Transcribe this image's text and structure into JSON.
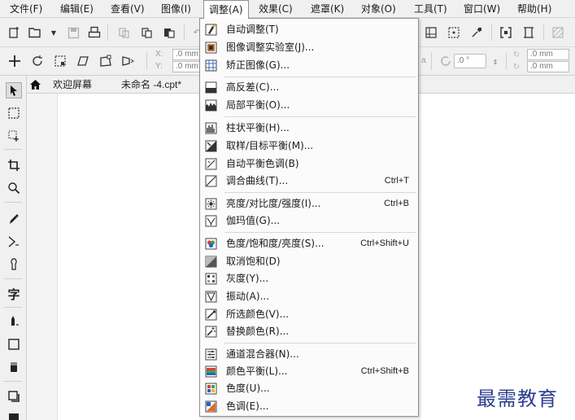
{
  "menubar": {
    "items": [
      {
        "label": "文件(F)"
      },
      {
        "label": "编辑(E)"
      },
      {
        "label": "查看(V)"
      },
      {
        "label": "图像(I)"
      },
      {
        "label": "调整(A)",
        "active": true
      },
      {
        "label": "效果(C)"
      },
      {
        "label": "遮罩(K)"
      },
      {
        "label": "对象(O)"
      },
      {
        "label": "工具(T)"
      },
      {
        "label": "窗口(W)"
      },
      {
        "label": "帮助(H)"
      }
    ]
  },
  "toolbar2": {
    "x_label": "X:",
    "y_label": "Y:",
    "x_value": ".0 mm",
    "y_value": ".0 mm",
    "rotation_value": ".0 °",
    "w_value": ".0 mm",
    "h_value": ".0 mm"
  },
  "doc_tabs": {
    "welcome": "欢迎屏幕",
    "document": "未命名 -4.cpt*"
  },
  "toolbox": {
    "text_tool_glyph": "字"
  },
  "adjust_menu": {
    "items": [
      {
        "label": "自动调整(T)",
        "shortcut": ""
      },
      {
        "label": "图像调整实验室(J)...",
        "shortcut": ""
      },
      {
        "label": "矫正图像(G)...",
        "shortcut": ""
      },
      {
        "label": "高反差(C)...",
        "shortcut": ""
      },
      {
        "label": "局部平衡(O)...",
        "shortcut": ""
      },
      {
        "label": "柱状平衡(H)...",
        "shortcut": ""
      },
      {
        "label": "取样/目标平衡(M)...",
        "shortcut": ""
      },
      {
        "label": "自动平衡色调(B)",
        "shortcut": ""
      },
      {
        "label": "调合曲线(T)...",
        "shortcut": "Ctrl+T"
      },
      {
        "label": "亮度/对比度/强度(I)...",
        "shortcut": "Ctrl+B"
      },
      {
        "label": "伽玛值(G)...",
        "shortcut": ""
      },
      {
        "label": "色度/饱和度/亮度(S)...",
        "shortcut": "Ctrl+Shift+U"
      },
      {
        "label": "取消饱和(D)",
        "shortcut": ""
      },
      {
        "label": "灰度(Y)...",
        "shortcut": ""
      },
      {
        "label": "振动(A)...",
        "shortcut": ""
      },
      {
        "label": "所选颜色(V)...",
        "shortcut": ""
      },
      {
        "label": "替换颜色(R)...",
        "shortcut": ""
      },
      {
        "label": "通道混合器(N)...",
        "shortcut": ""
      },
      {
        "label": "颜色平衡(L)...",
        "shortcut": "Ctrl+Shift+B"
      },
      {
        "label": "色度(U)...",
        "shortcut": ""
      },
      {
        "label": "色调(E)...",
        "shortcut": ""
      }
    ]
  },
  "watermark": "最需教育",
  "colors": {
    "menu_bg": "#f0f0f0",
    "dropdown_bg": "#fbfbfb",
    "watermark": "#2b3f8f"
  }
}
